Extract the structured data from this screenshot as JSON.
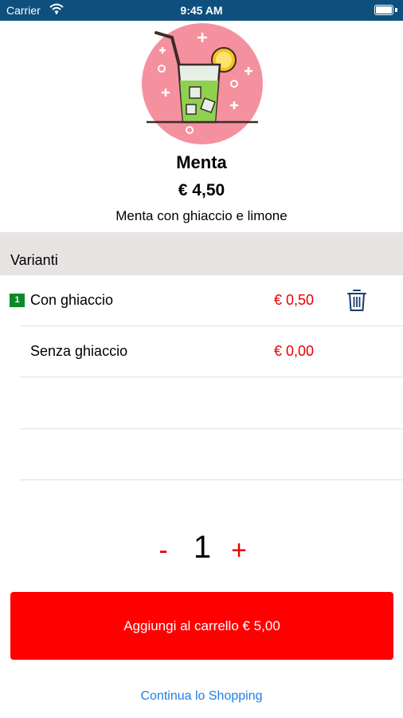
{
  "status_bar": {
    "carrier": "Carrier",
    "time": "9:45 AM"
  },
  "product": {
    "name": "Menta",
    "price": "€ 4,50",
    "description": "Menta con ghiaccio e limone",
    "image_icon": "mint-drink-icon"
  },
  "section": {
    "title": "Varianti"
  },
  "variants": [
    {
      "quantity": "1",
      "name": "Con ghiaccio",
      "price": "€ 0,50",
      "has_delete": true
    },
    {
      "name": "Senza ghiaccio",
      "price": "€ 0,00",
      "has_delete": false
    }
  ],
  "quantity": {
    "minus": "-",
    "value": "1",
    "plus": "+"
  },
  "add_button": {
    "label": "Aggiungi al carrello € 5,00"
  },
  "continue_link": {
    "label": "Continua lo Shopping"
  },
  "colors": {
    "status_bar": "#0f4f7e",
    "accent_red": "#ff0000",
    "price_red": "#e60000",
    "link_blue": "#1e7fe6",
    "section_bg": "#e8e3e3",
    "badge_green": "#0a8a28"
  }
}
